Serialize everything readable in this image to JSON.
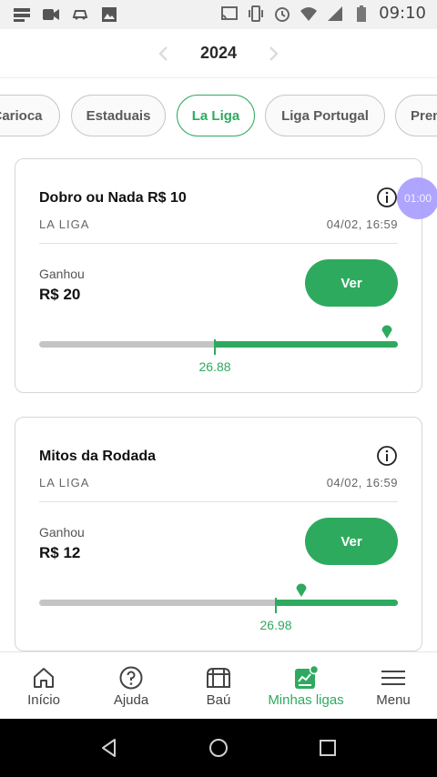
{
  "status_bar": {
    "time": "09:10",
    "left_icons": [
      "cast-app-icon",
      "video-camera-icon",
      "car-icon",
      "image-icon"
    ],
    "right_icons": [
      "cast-icon",
      "vibrate-icon",
      "alarm-icon",
      "wifi-icon",
      "signal-icon",
      "battery-icon"
    ]
  },
  "header": {
    "year": "2024",
    "prev_icon": "chevron-left-icon",
    "next_icon": "chevron-right-icon"
  },
  "chips": [
    {
      "label": "Carioca",
      "active": false
    },
    {
      "label": "Estaduais",
      "active": false
    },
    {
      "label": "La Liga",
      "active": true
    },
    {
      "label": "Liga Portugal",
      "active": false
    },
    {
      "label": "Premier League",
      "active": false
    }
  ],
  "cards": [
    {
      "title": "Dobro ou Nada R$ 10",
      "league": "LA LIGA",
      "date": "04/02, 16:59",
      "status": "Ganhou",
      "amount": "R$ 20",
      "button": "Ver",
      "score": "26.88",
      "cutoff_fraction": 0.49,
      "pin_fraction": 0.97
    },
    {
      "title": "Mitos da Rodada",
      "league": "LA LIGA",
      "date": "04/02, 16:59",
      "status": "Ganhou",
      "amount": "R$ 12",
      "button": "Ver",
      "score": "26.98",
      "cutoff_fraction": 0.66,
      "pin_fraction": 0.73
    }
  ],
  "timer": {
    "label": "01:00"
  },
  "bottom_nav": [
    {
      "label": "Início",
      "icon": "home-icon",
      "active": false
    },
    {
      "label": "Ajuda",
      "icon": "help-icon",
      "active": false
    },
    {
      "label": "Baú",
      "icon": "chest-icon",
      "active": false
    },
    {
      "label": "Minhas ligas",
      "icon": "my-leagues-icon",
      "active": true
    },
    {
      "label": "Menu",
      "icon": "menu-icon",
      "active": false
    }
  ],
  "colors": {
    "accent": "#2eaa5f",
    "track": "#c4c4c4",
    "timer": "#a79cff"
  }
}
